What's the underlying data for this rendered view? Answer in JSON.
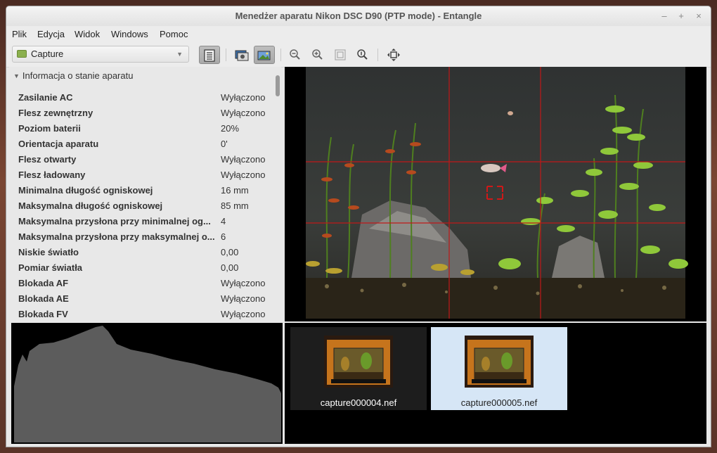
{
  "window": {
    "title": "Menedżer aparatu Nikon DSC D90 (PTP mode) - Entangle",
    "controls": {
      "minimize": "–",
      "maximize": "+",
      "close": "×"
    }
  },
  "menubar": {
    "items": [
      "Plik",
      "Edycja",
      "Widok",
      "Windows",
      "Pomoc"
    ]
  },
  "toolbar": {
    "session_combo": {
      "value": "Capture",
      "arrow": "▼"
    },
    "icons": [
      "settings-panel-icon",
      "capture-icon",
      "preview-icon",
      "zoom-out-icon",
      "zoom-in-icon",
      "zoom-fit-icon",
      "zoom-normal-icon",
      "fullscreen-icon"
    ]
  },
  "camera_info": {
    "section_title": "Informacja o stanie aparatu",
    "properties": [
      {
        "key": "Zasilanie AC",
        "value": "Wyłączono"
      },
      {
        "key": "Flesz zewnętrzny",
        "value": "Wyłączono"
      },
      {
        "key": "Poziom baterii",
        "value": "20%"
      },
      {
        "key": "Orientacja aparatu",
        "value": "0'"
      },
      {
        "key": "Flesz otwarty",
        "value": "Wyłączono"
      },
      {
        "key": "Flesz ładowany",
        "value": "Wyłączono"
      },
      {
        "key": "Minimalna długość ogniskowej",
        "value": "16 mm"
      },
      {
        "key": "Maksymalna długość ogniskowej",
        "value": "85 mm"
      },
      {
        "key": "Maksymalna przysłona przy minimalnej og...",
        "value": "4"
      },
      {
        "key": "Maksymalna przysłona przy maksymalnej o...",
        "value": "6"
      },
      {
        "key": "Niskie światło",
        "value": "0,00"
      },
      {
        "key": "Pomiar światła",
        "value": "0,00"
      },
      {
        "key": "Blokada AF",
        "value": "Wyłączono"
      },
      {
        "key": "Blokada AE",
        "value": "Wyłączono"
      },
      {
        "key": "Blokada FV",
        "value": "Wyłączono"
      }
    ]
  },
  "thumbnails": [
    {
      "filename": "capture000004.nef",
      "selected": false
    },
    {
      "filename": "capture000005.nef",
      "selected": true
    }
  ]
}
